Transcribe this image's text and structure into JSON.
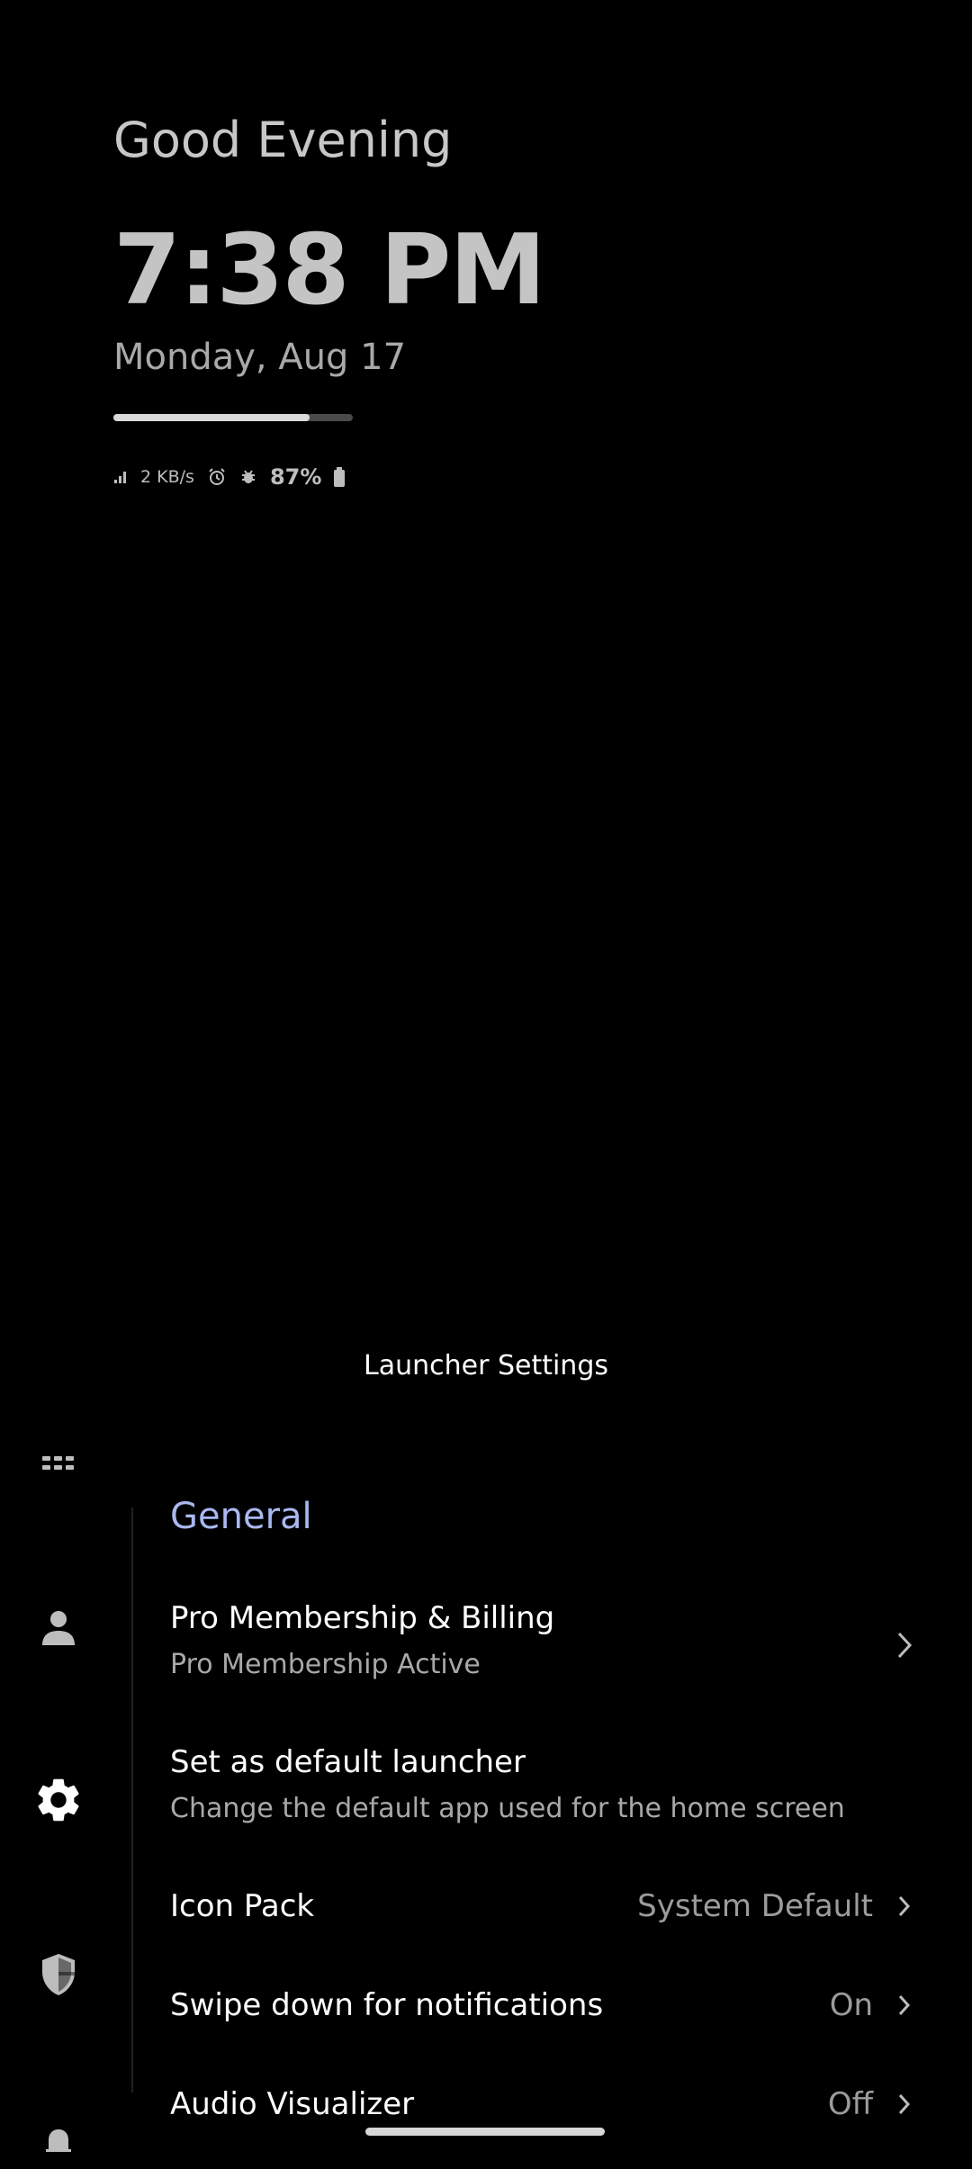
{
  "home": {
    "greeting": "Good Evening",
    "time": "7:38 PM",
    "date": "Monday, Aug 17",
    "progress_percent": 82,
    "status": {
      "network_speed": "2 KB/s",
      "battery": "87%",
      "icons": [
        "signal-icon",
        "alarm-icon",
        "bug-icon",
        "battery-icon"
      ]
    }
  },
  "sheet": {
    "title": "Launcher Settings",
    "rail_icons": [
      "apps-grid-icon",
      "person-icon",
      "gear-icon",
      "shield-icon",
      "bell-icon"
    ],
    "rail_selected": "gear-icon"
  },
  "settings": {
    "section": "General",
    "items": [
      {
        "title": "Pro Membership & Billing",
        "subtitle": "Pro Membership Active"
      },
      {
        "title": "Set as default launcher",
        "subtitle": "Change the default app used for the home screen"
      },
      {
        "title": "Icon Pack",
        "value": "System Default"
      },
      {
        "title": "Swipe down for notifications",
        "value": "On"
      },
      {
        "title": "Audio Visualizer",
        "value": "Off"
      }
    ]
  },
  "colors": {
    "background": "#000000",
    "accent": "#a9b8f0",
    "text_primary": "#ffffff",
    "text_secondary": "#a8a8a8"
  }
}
